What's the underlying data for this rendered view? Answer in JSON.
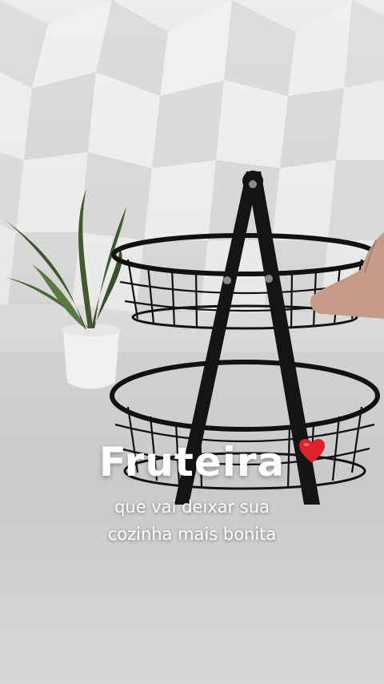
{
  "caption": {
    "title": "Fruteira",
    "line1": "que vai deixar sua",
    "line2": "cozinha mais bonita"
  },
  "icons": {
    "heart": "red-heart-emoji"
  },
  "colors": {
    "wall": "#ebeaea",
    "counter": "#cfcecc",
    "basket": "#111111",
    "heart": "#e0202b",
    "text": "#ffffff"
  }
}
